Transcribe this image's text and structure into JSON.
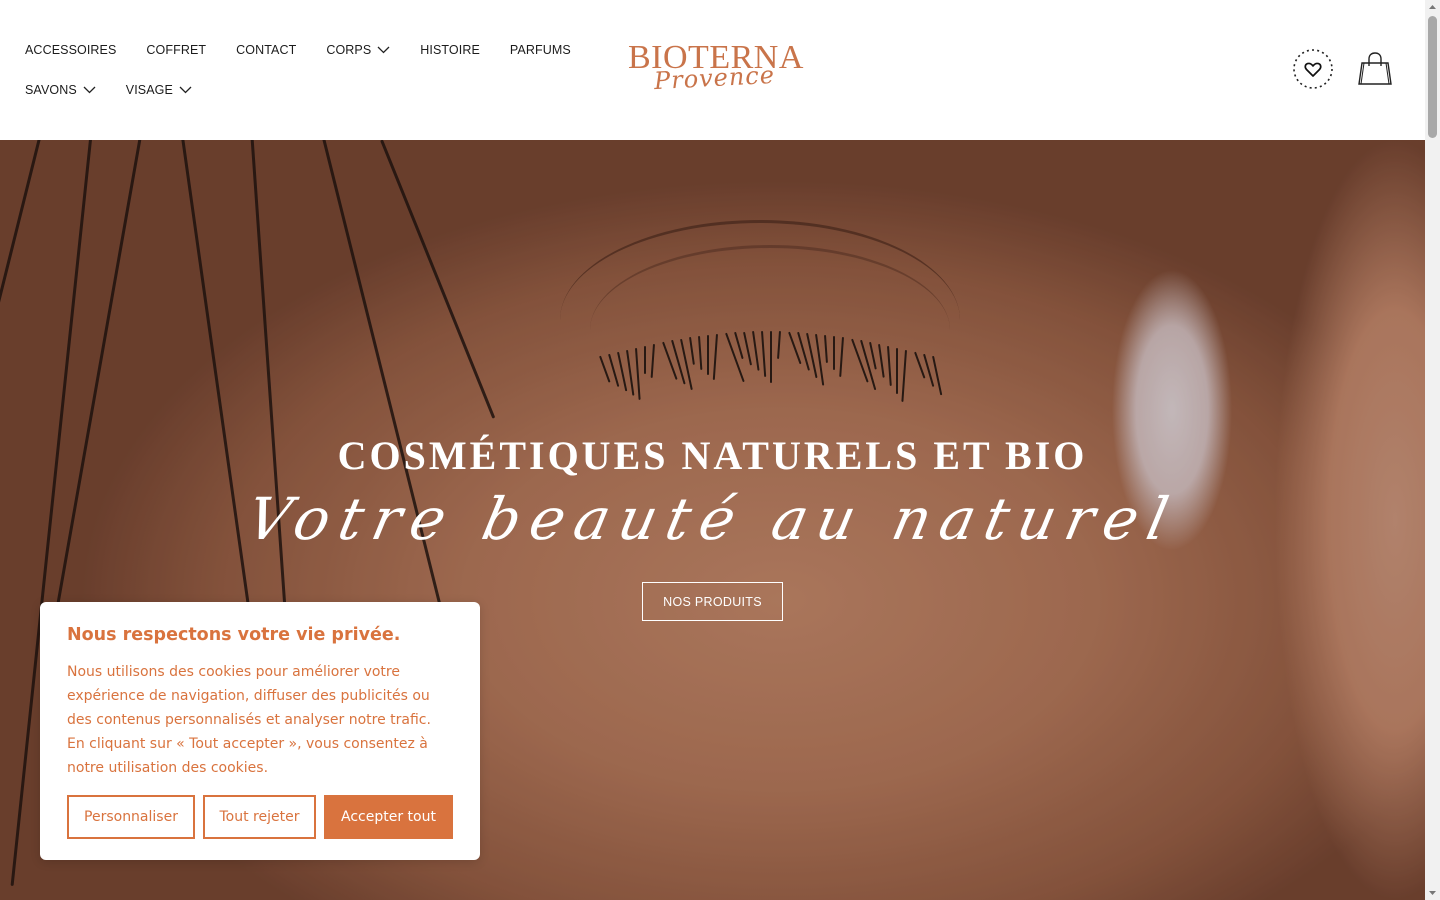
{
  "nav": {
    "row1": [
      {
        "label": "ACCESSOIRES",
        "dropdown": false
      },
      {
        "label": "COFFRET",
        "dropdown": false
      },
      {
        "label": "CONTACT",
        "dropdown": false
      },
      {
        "label": "CORPS",
        "dropdown": true
      },
      {
        "label": "HISTOIRE",
        "dropdown": false
      },
      {
        "label": "PARFUMS",
        "dropdown": false
      }
    ],
    "row2": [
      {
        "label": "SAVONS",
        "dropdown": true
      },
      {
        "label": "VISAGE",
        "dropdown": true
      }
    ]
  },
  "logo": {
    "main": "BIOTERNA",
    "script": "Provence"
  },
  "header_icons": {
    "wishlist": "heart-icon",
    "cart": "shopping-bag-icon"
  },
  "hero": {
    "title": "COSMÉTIQUES NATURELS ET BIO",
    "subtitle": "Votre beauté au naturel",
    "button": "NOS PRODUITS"
  },
  "cookie": {
    "title": "Nous respectons votre vie privée.",
    "text": "Nous utilisons des cookies pour améliorer votre expérience de navigation, diffuser des publicités ou des contenus personnalisés et analyser notre trafic. En cliquant sur « Tout accepter », vous consentez à notre utilisation des cookies.",
    "buttons": {
      "customize": "Personnaliser",
      "reject": "Tout rejeter",
      "accept": "Accepter tout"
    }
  },
  "colors": {
    "brand": "#c9744a",
    "cookie_accent": "#d9733e",
    "nav_text": "#1c1c1c"
  }
}
